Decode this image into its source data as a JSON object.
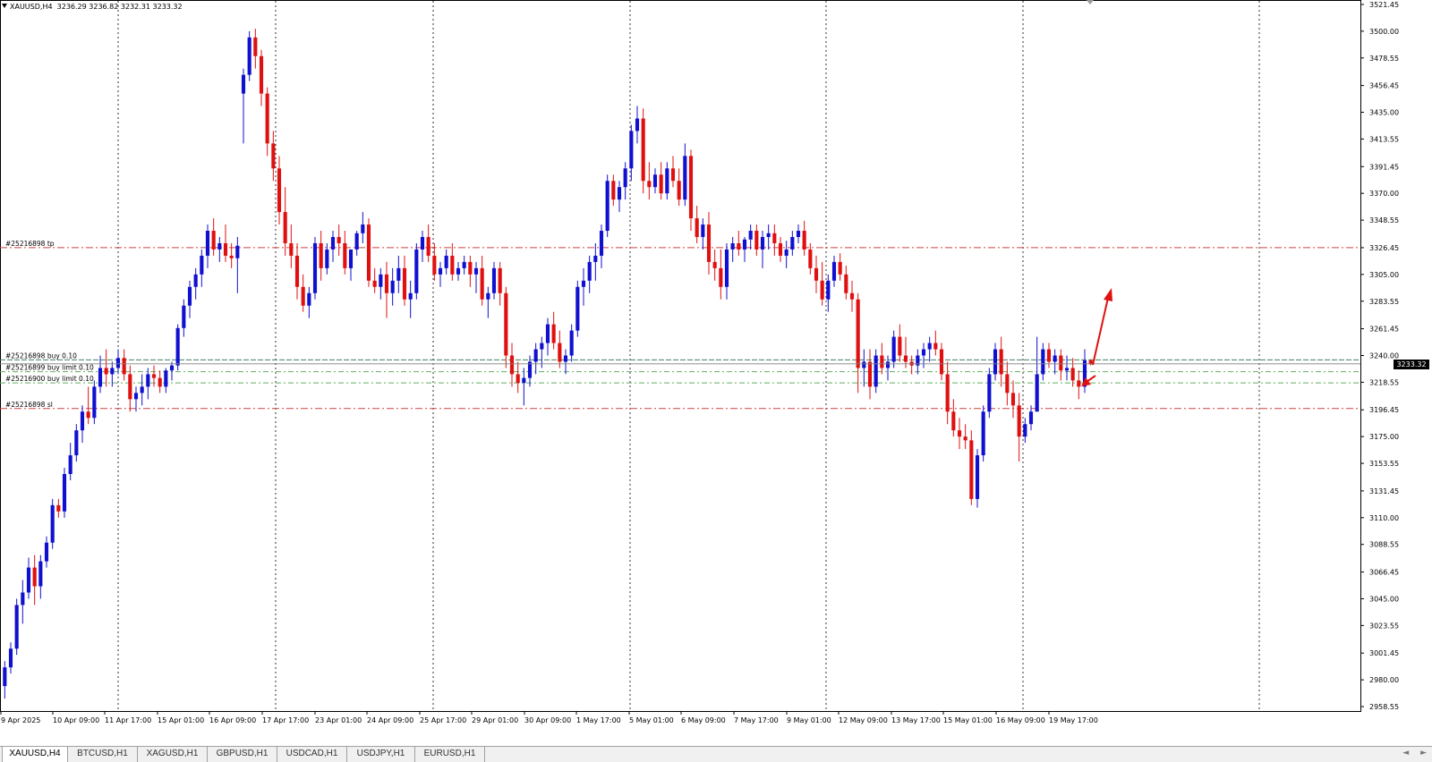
{
  "chart": {
    "symbol": "XAUUSD,H4",
    "ohlc": "3236.29 3236.82 3232.31 3233.32",
    "current_price": "3233.32",
    "up_color": "#1010d0",
    "down_color": "#e01010",
    "tp_line_color": "#d04040",
    "sl_line_color": "#d04040",
    "buy_line_color": "#40a060"
  },
  "chart_data": {
    "type": "candlestick",
    "y_ticks": [
      "3521.45",
      "3500.00",
      "3478.55",
      "3456.45",
      "3435.00",
      "3413.55",
      "3391.45",
      "3370.00",
      "3348.55",
      "3326.45",
      "3305.00",
      "3283.55",
      "3261.45",
      "3240.00",
      "3218.55",
      "3196.45",
      "3175.00",
      "3153.55",
      "3131.45",
      "3110.00",
      "3088.55",
      "3066.45",
      "3045.00",
      "3023.55",
      "3001.45",
      "2980.00",
      "2958.55"
    ],
    "ylim": [
      2955,
      3525
    ],
    "x_labels": [
      "9 Apr 2025",
      "10 Apr 09:00",
      "11 Apr 17:00",
      "15 Apr 01:00",
      "16 Apr 09:00",
      "17 Apr 17:00",
      "23 Apr 01:00",
      "24 Apr 09:00",
      "25 Apr 17:00",
      "29 Apr 01:00",
      "30 Apr 09:00",
      "1 May 17:00",
      "5 May 01:00",
      "6 May 09:00",
      "7 May 17:00",
      "9 May 01:00",
      "12 May 09:00",
      "13 May 17:00",
      "15 May 01:00",
      "16 May 09:00",
      "19 May 17:00"
    ],
    "candles": [
      [
        2975,
        2995,
        2965,
        2990
      ],
      [
        2990,
        3010,
        2985,
        3005
      ],
      [
        3005,
        3045,
        3000,
        3040
      ],
      [
        3040,
        3060,
        3025,
        3050
      ],
      [
        3050,
        3078,
        3045,
        3070
      ],
      [
        3070,
        3080,
        3040,
        3055
      ],
      [
        3055,
        3080,
        3045,
        3075
      ],
      [
        3075,
        3095,
        3070,
        3090
      ],
      [
        3090,
        3125,
        3085,
        3120
      ],
      [
        3120,
        3125,
        3110,
        3115
      ],
      [
        3115,
        3150,
        3110,
        3145
      ],
      [
        3145,
        3170,
        3140,
        3160
      ],
      [
        3160,
        3185,
        3155,
        3180
      ],
      [
        3180,
        3200,
        3170,
        3195
      ],
      [
        3195,
        3215,
        3185,
        3190
      ],
      [
        3190,
        3220,
        3185,
        3215
      ],
      [
        3215,
        3240,
        3210,
        3230
      ],
      [
        3230,
        3245,
        3215,
        3225
      ],
      [
        3225,
        3235,
        3215,
        3230
      ],
      [
        3230,
        3245,
        3225,
        3238
      ],
      [
        3238,
        3245,
        3220,
        3225
      ],
      [
        3225,
        3232,
        3195,
        3205
      ],
      [
        3205,
        3215,
        3195,
        3210
      ],
      [
        3210,
        3225,
        3200,
        3215
      ],
      [
        3215,
        3230,
        3205,
        3225
      ],
      [
        3225,
        3232,
        3215,
        3222
      ],
      [
        3222,
        3228,
        3210,
        3215
      ],
      [
        3215,
        3230,
        3210,
        3228
      ],
      [
        3228,
        3235,
        3220,
        3232
      ],
      [
        3232,
        3265,
        3228,
        3262
      ],
      [
        3262,
        3285,
        3255,
        3280
      ],
      [
        3280,
        3300,
        3270,
        3295
      ],
      [
        3295,
        3310,
        3285,
        3305
      ],
      [
        3305,
        3325,
        3295,
        3320
      ],
      [
        3320,
        3345,
        3310,
        3340
      ],
      [
        3340,
        3350,
        3320,
        3325
      ],
      [
        3325,
        3335,
        3315,
        3330
      ],
      [
        3330,
        3345,
        3315,
        3320
      ],
      [
        3320,
        3330,
        3310,
        3318
      ],
      [
        3318,
        3335,
        3290,
        3328
      ],
      [
        3450,
        3470,
        3410,
        3465
      ],
      [
        3465,
        3500,
        3460,
        3495
      ],
      [
        3495,
        3502,
        3470,
        3480
      ],
      [
        3480,
        3485,
        3440,
        3450
      ],
      [
        3450,
        3455,
        3400,
        3410
      ],
      [
        3410,
        3420,
        3380,
        3390
      ],
      [
        3390,
        3400,
        3345,
        3355
      ],
      [
        3355,
        3375,
        3320,
        3330
      ],
      [
        3330,
        3345,
        3310,
        3320
      ],
      [
        3320,
        3330,
        3285,
        3295
      ],
      [
        3295,
        3305,
        3275,
        3280
      ],
      [
        3280,
        3295,
        3270,
        3290
      ],
      [
        3290,
        3335,
        3285,
        3330
      ],
      [
        3330,
        3340,
        3300,
        3310
      ],
      [
        3310,
        3330,
        3305,
        3325
      ],
      [
        3325,
        3340,
        3315,
        3335
      ],
      [
        3335,
        3345,
        3320,
        3330
      ],
      [
        3330,
        3340,
        3305,
        3310
      ],
      [
        3310,
        3320,
        3300,
        3325
      ],
      [
        3325,
        3340,
        3320,
        3338
      ],
      [
        3338,
        3355,
        3330,
        3345
      ],
      [
        3345,
        3350,
        3295,
        3300
      ],
      [
        3300,
        3310,
        3290,
        3295
      ],
      [
        3295,
        3310,
        3285,
        3305
      ],
      [
        3305,
        3315,
        3270,
        3290
      ],
      [
        3290,
        3310,
        3280,
        3300
      ],
      [
        3300,
        3320,
        3290,
        3310
      ],
      [
        3310,
        3320,
        3280,
        3285
      ],
      [
        3285,
        3300,
        3270,
        3290
      ],
      [
        3290,
        3330,
        3285,
        3325
      ],
      [
        3325,
        3340,
        3315,
        3335
      ],
      [
        3335,
        3345,
        3315,
        3320
      ],
      [
        3320,
        3330,
        3300,
        3305
      ],
      [
        3305,
        3315,
        3295,
        3310
      ],
      [
        3310,
        3325,
        3305,
        3320
      ],
      [
        3320,
        3330,
        3300,
        3305
      ],
      [
        3305,
        3315,
        3300,
        3310
      ],
      [
        3310,
        3320,
        3305,
        3315
      ],
      [
        3315,
        3320,
        3295,
        3305
      ],
      [
        3305,
        3315,
        3290,
        3310
      ],
      [
        3310,
        3320,
        3280,
        3285
      ],
      [
        3285,
        3295,
        3270,
        3290
      ],
      [
        3290,
        3315,
        3285,
        3310
      ],
      [
        3310,
        3315,
        3280,
        3290
      ],
      [
        3290,
        3295,
        3230,
        3240
      ],
      [
        3240,
        3250,
        3215,
        3225
      ],
      [
        3225,
        3235,
        3210,
        3218
      ],
      [
        3218,
        3230,
        3200,
        3222
      ],
      [
        3222,
        3240,
        3215,
        3235
      ],
      [
        3235,
        3250,
        3225,
        3245
      ],
      [
        3245,
        3255,
        3230,
        3250
      ],
      [
        3250,
        3270,
        3240,
        3265
      ],
      [
        3265,
        3275,
        3245,
        3250
      ],
      [
        3250,
        3260,
        3230,
        3235
      ],
      [
        3235,
        3245,
        3225,
        3240
      ],
      [
        3240,
        3265,
        3235,
        3260
      ],
      [
        3260,
        3300,
        3255,
        3295
      ],
      [
        3295,
        3310,
        3280,
        3300
      ],
      [
        3300,
        3320,
        3290,
        3315
      ],
      [
        3315,
        3330,
        3300,
        3320
      ],
      [
        3320,
        3345,
        3310,
        3340
      ],
      [
        3340,
        3385,
        3335,
        3380
      ],
      [
        3380,
        3385,
        3360,
        3365
      ],
      [
        3365,
        3380,
        3355,
        3375
      ],
      [
        3375,
        3395,
        3365,
        3390
      ],
      [
        3390,
        3425,
        3380,
        3420
      ],
      [
        3420,
        3440,
        3410,
        3430
      ],
      [
        3430,
        3438,
        3370,
        3380
      ],
      [
        3380,
        3395,
        3365,
        3375
      ],
      [
        3375,
        3390,
        3370,
        3385
      ],
      [
        3385,
        3395,
        3365,
        3370
      ],
      [
        3370,
        3395,
        3365,
        3390
      ],
      [
        3390,
        3400,
        3375,
        3380
      ],
      [
        3380,
        3390,
        3360,
        3365
      ],
      [
        3365,
        3410,
        3360,
        3400
      ],
      [
        3400,
        3405,
        3340,
        3350
      ],
      [
        3350,
        3360,
        3330,
        3335
      ],
      [
        3335,
        3350,
        3325,
        3345
      ],
      [
        3345,
        3355,
        3305,
        3315
      ],
      [
        3315,
        3325,
        3300,
        3310
      ],
      [
        3310,
        3325,
        3285,
        3295
      ],
      [
        3295,
        3330,
        3285,
        3325
      ],
      [
        3325,
        3335,
        3315,
        3330
      ],
      [
        3330,
        3340,
        3320,
        3325
      ],
      [
        3325,
        3335,
        3315,
        3333
      ],
      [
        3333,
        3345,
        3325,
        3340
      ],
      [
        3340,
        3345,
        3320,
        3325
      ],
      [
        3325,
        3340,
        3310,
        3335
      ],
      [
        3335,
        3345,
        3325,
        3338
      ],
      [
        3338,
        3345,
        3320,
        3330
      ],
      [
        3330,
        3335,
        3315,
        3320
      ],
      [
        3320,
        3332,
        3310,
        3325
      ],
      [
        3325,
        3340,
        3320,
        3335
      ],
      [
        3335,
        3345,
        3330,
        3340
      ],
      [
        3340,
        3348,
        3320,
        3325
      ],
      [
        3325,
        3330,
        3305,
        3310
      ],
      [
        3310,
        3320,
        3290,
        3300
      ],
      [
        3300,
        3315,
        3280,
        3285
      ],
      [
        3285,
        3305,
        3275,
        3300
      ],
      [
        3300,
        3320,
        3295,
        3315
      ],
      [
        3315,
        3322,
        3300,
        3305
      ],
      [
        3305,
        3312,
        3285,
        3290
      ],
      [
        3290,
        3300,
        3275,
        3285
      ],
      [
        3285,
        3290,
        3210,
        3230
      ],
      [
        3230,
        3245,
        3215,
        3235
      ],
      [
        3235,
        3245,
        3205,
        3215
      ],
      [
        3215,
        3245,
        3210,
        3240
      ],
      [
        3240,
        3250,
        3225,
        3230
      ],
      [
        3230,
        3240,
        3220,
        3235
      ],
      [
        3235,
        3260,
        3230,
        3255
      ],
      [
        3255,
        3265,
        3235,
        3240
      ],
      [
        3240,
        3255,
        3230,
        3235
      ],
      [
        3235,
        3240,
        3225,
        3232
      ],
      [
        3232,
        3245,
        3225,
        3240
      ],
      [
        3240,
        3250,
        3230,
        3245
      ],
      [
        3245,
        3255,
        3235,
        3250
      ],
      [
        3250,
        3260,
        3240,
        3245
      ],
      [
        3245,
        3250,
        3220,
        3225
      ],
      [
        3225,
        3235,
        3185,
        3195
      ],
      [
        3195,
        3205,
        3175,
        3180
      ],
      [
        3180,
        3190,
        3165,
        3175
      ],
      [
        3175,
        3185,
        3165,
        3172
      ],
      [
        3172,
        3180,
        3120,
        3125
      ],
      [
        3125,
        3165,
        3118,
        3160
      ],
      [
        3160,
        3200,
        3155,
        3195
      ],
      [
        3195,
        3230,
        3190,
        3225
      ],
      [
        3225,
        3250,
        3220,
        3245
      ],
      [
        3245,
        3255,
        3215,
        3225
      ],
      [
        3225,
        3235,
        3200,
        3210
      ],
      [
        3210,
        3220,
        3190,
        3200
      ],
      [
        3200,
        3210,
        3155,
        3175
      ],
      [
        3175,
        3190,
        3170,
        3185
      ],
      [
        3185,
        3200,
        3180,
        3195
      ],
      [
        3195,
        3255,
        3215,
        3225
      ],
      [
        3225,
        3250,
        3220,
        3245
      ],
      [
        3245,
        3250,
        3230,
        3235
      ],
      [
        3235,
        3245,
        3225,
        3240
      ],
      [
        3240,
        3245,
        3220,
        3228
      ],
      [
        3228,
        3240,
        3220,
        3230
      ],
      [
        3230,
        3238,
        3215,
        3220
      ],
      [
        3220,
        3228,
        3205,
        3215
      ],
      [
        3215,
        3245,
        3210,
        3236
      ],
      [
        3236,
        3237,
        3232,
        3233
      ]
    ],
    "horizontal_lines": [
      {
        "label": "#25216898 tp",
        "value": 3326.45,
        "kind": "tp"
      },
      {
        "label": "#25216898 buy 0.10",
        "value": 3236.5,
        "kind": "buy"
      },
      {
        "label": "#25216899 buy limit 0.10",
        "value": 3227.0,
        "kind": "limit"
      },
      {
        "label": "#25216900 buy limit 0.10",
        "value": 3218.0,
        "kind": "limit"
      },
      {
        "label": "#25216898 sl",
        "value": 3197.5,
        "kind": "sl"
      }
    ],
    "grid": "vertical-dashed"
  },
  "tabs": [
    {
      "label": "XAUUSD,H4",
      "active": true
    },
    {
      "label": "BTCUSD,H1",
      "active": false
    },
    {
      "label": "XAGUSD,H1",
      "active": false
    },
    {
      "label": "GBPUSD,H1",
      "active": false
    },
    {
      "label": "USDCAD,H1",
      "active": false
    },
    {
      "label": "USDJPY,H1",
      "active": false
    },
    {
      "label": "EURUSD,H1",
      "active": false
    }
  ],
  "scroll": {
    "left": "◄",
    "right": "►"
  }
}
